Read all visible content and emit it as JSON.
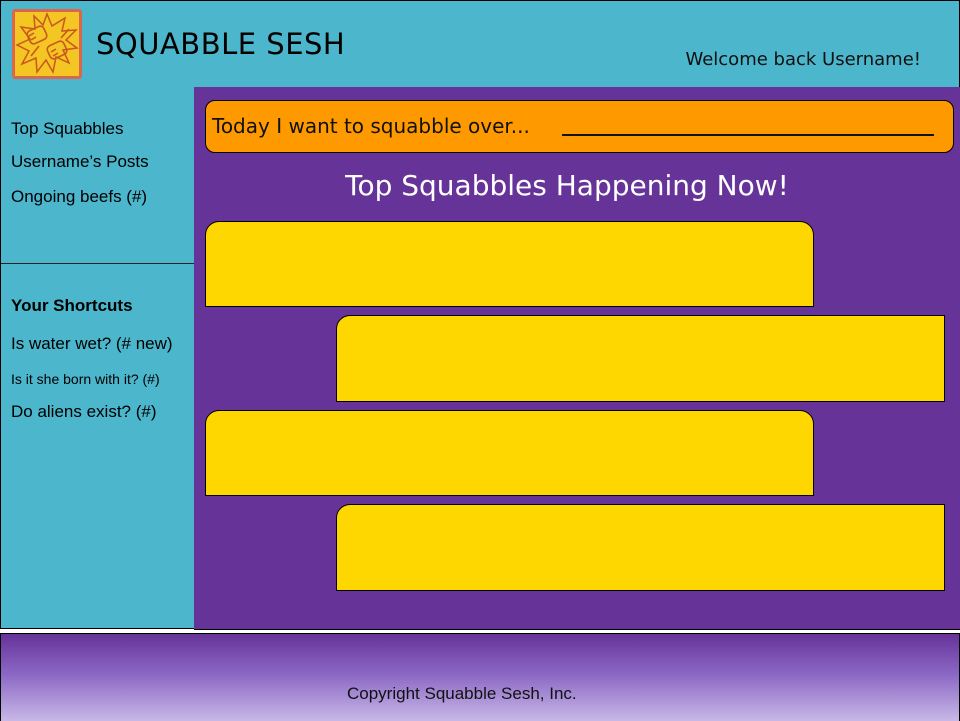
{
  "header": {
    "brand_title": "SQUABBLE SESH",
    "welcome": "Welcome back Username!",
    "logo_icon": "fists-icon"
  },
  "sidebar": {
    "nav_items": [
      {
        "label": "Top Squabbles"
      },
      {
        "label": "Username’s Posts"
      },
      {
        "label": "Ongoing beefs (#)"
      }
    ],
    "shortcuts_heading": "Your Shortcuts",
    "shortcuts": [
      {
        "label": "Is water wet? (# new)"
      },
      {
        "label": "Is it she born with it?  (#)"
      },
      {
        "label": "Do aliens exist?  (#)"
      }
    ]
  },
  "main": {
    "prompt_text": "Today I want to squabble over...",
    "section_heading": "Top Squabbles Happening Now!"
  },
  "footer": {
    "copyright": "Copyright Squabble Sesh, Inc."
  },
  "colors": {
    "header_bg": "#4bb6cc",
    "main_bg": "#663399",
    "prompt_bg": "#ff9900",
    "card_bg": "#ffd700"
  }
}
